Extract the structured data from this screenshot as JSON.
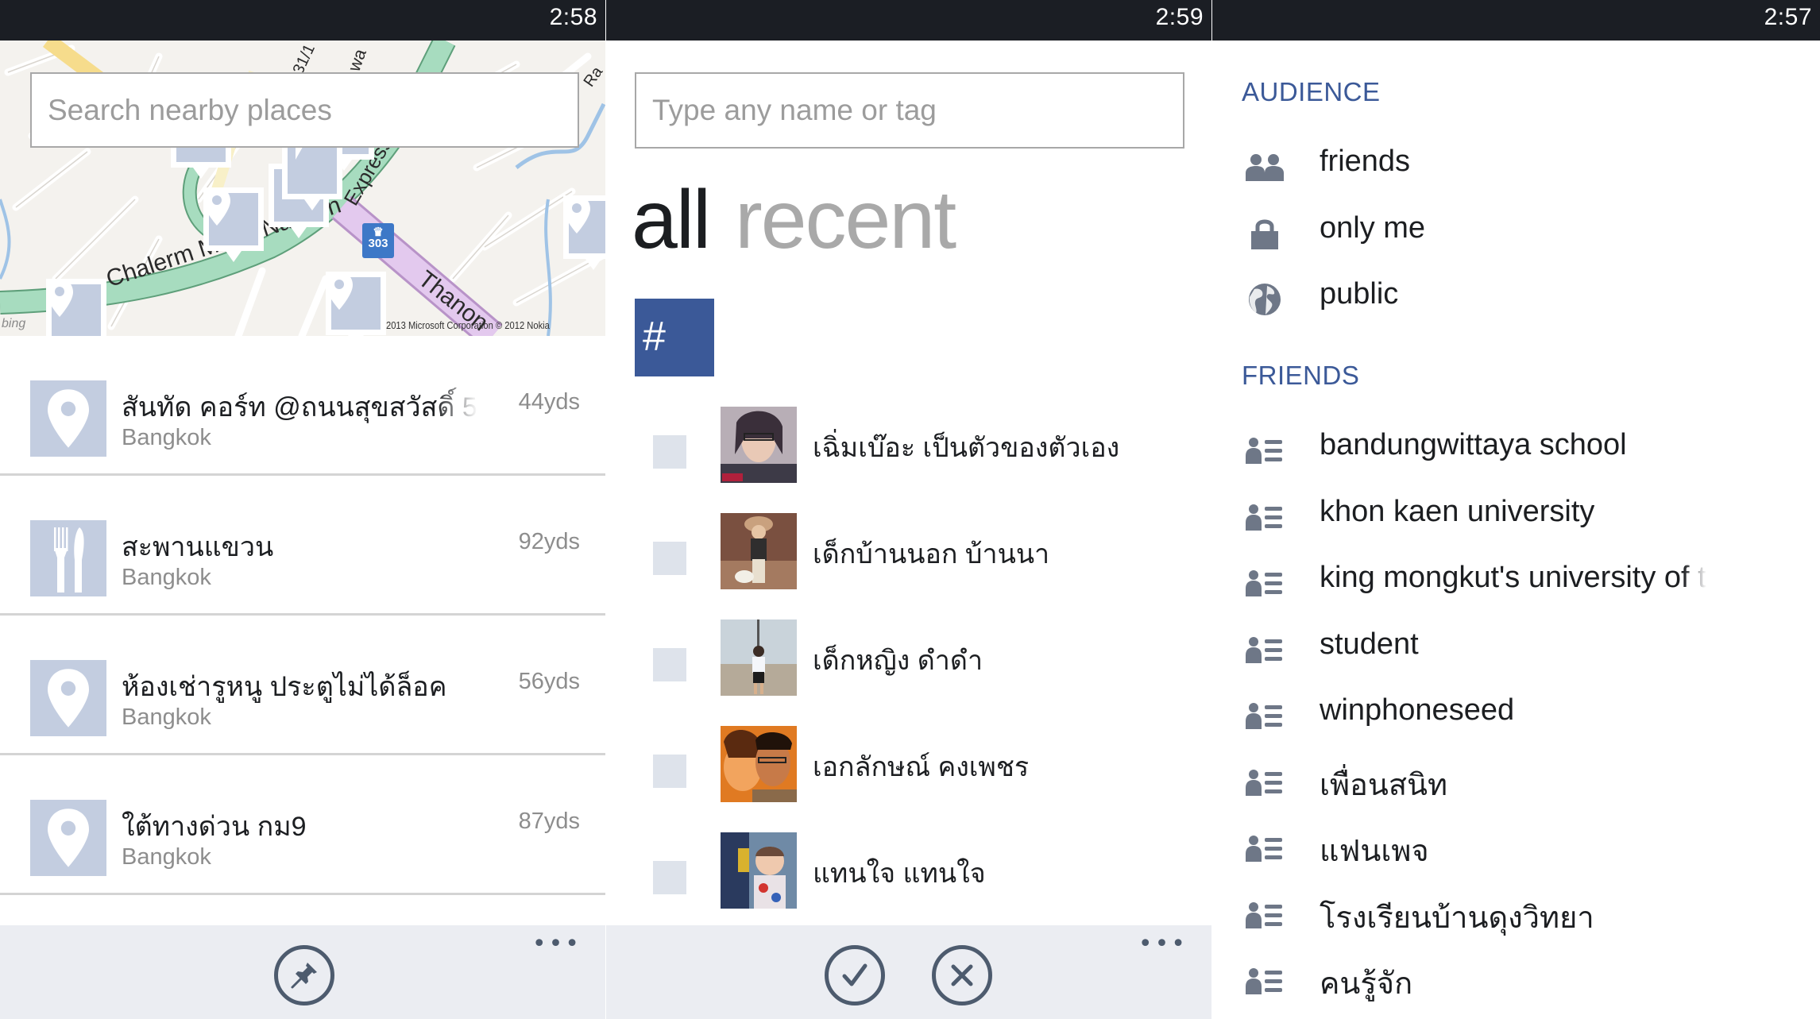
{
  "colors": {
    "status_bar": "#1b1e24",
    "accent": "#3b5998",
    "tile_placeholder": "#c3cde0",
    "app_bar": "#ebedf2",
    "icon_gray": "#4d5b6e"
  },
  "places_screen": {
    "status_time": "2:58",
    "search": {
      "placeholder": "Search nearby places",
      "value": ""
    },
    "map": {
      "labels": {
        "road_1": "Chalerm Maha Nakhon",
        "road_2": "Thanon",
        "road_3": "Expressway",
        "road_4": "31/1",
        "road_5": "Ra",
        "road_6": "wa",
        "route_number": "303"
      },
      "attribution": "2013 Microsoft Corporation © 2012 Nokia",
      "logo": "bing"
    },
    "places": [
      {
        "title": "สันทัด คอร์ท @ถนนสุขสวัสดิ์ 5",
        "subtitle": "Bangkok",
        "distance": "44yds",
        "icon": "map-pin-icon"
      },
      {
        "title": "สะพานแขวน",
        "subtitle": "Bangkok",
        "distance": "92yds",
        "icon": "fork-knife-icon"
      },
      {
        "title": "ห้องเช่ารูหนู ประตูไม่ได้ล็อค",
        "subtitle": "Bangkok",
        "distance": "56yds",
        "icon": "map-pin-icon"
      },
      {
        "title": "ใต้ทางด่วน กม9",
        "subtitle": "Bangkok",
        "distance": "87yds",
        "icon": "map-pin-icon"
      }
    ],
    "app_bar": {
      "pin_icon": "pin-icon",
      "more": "•••"
    }
  },
  "tag_screen": {
    "status_time": "2:59",
    "search": {
      "placeholder": "Type any name or tag",
      "value": ""
    },
    "pivots": [
      {
        "label": "all",
        "active": true
      },
      {
        "label": "recent",
        "active": false
      }
    ],
    "hash_tile": "#",
    "friends": [
      {
        "name": "เฉิ่มเบ๊อะ เป็นตัวของตัวเอง",
        "checked": false
      },
      {
        "name": "เด็กบ้านนอก บ้านนา",
        "checked": false
      },
      {
        "name": "เด็กหญิง ดำดำ",
        "checked": false
      },
      {
        "name": "เอกลักษณ์ คงเพชร",
        "checked": false
      },
      {
        "name": "แทนใจ แทนใจ",
        "checked": false
      }
    ],
    "app_bar": {
      "confirm_icon": "check-icon",
      "cancel_icon": "close-icon",
      "more": "•••"
    }
  },
  "audience_screen": {
    "status_time": "2:57",
    "audience_header": "AUDIENCE",
    "audience": [
      {
        "label": "friends",
        "icon": "friends-icon"
      },
      {
        "label": "only me",
        "icon": "lock-icon"
      },
      {
        "label": "public",
        "icon": "globe-icon"
      }
    ],
    "friends_header": "FRIENDS",
    "friend_lists": [
      {
        "label": "bandungwittaya school"
      },
      {
        "label": "khon kaen university"
      },
      {
        "label": "king mongkut's university of t"
      },
      {
        "label": "student"
      },
      {
        "label": "winphoneseed"
      },
      {
        "label": "เพื่อนสนิท"
      },
      {
        "label": "แฟนเพจ"
      },
      {
        "label": "โรงเรียนบ้านดุงวิทยา"
      },
      {
        "label": "คนรู้จัก"
      }
    ]
  }
}
